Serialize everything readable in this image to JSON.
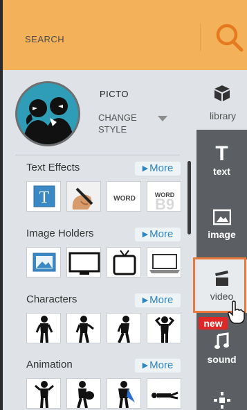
{
  "search": {
    "placeholder": "SEARCH"
  },
  "style": {
    "name": "PICTO",
    "change_line1": "CHANGE",
    "change_line2": "STYLE"
  },
  "library": {
    "label": "library"
  },
  "sections": [
    {
      "title": "Text Effects",
      "more": "More",
      "thumbs": [
        "text-box-icon",
        "pen-hand-thumb",
        "word-outline-thumb",
        "word-textured-thumb"
      ],
      "thumb_text": [
        "WORD",
        "WORD"
      ]
    },
    {
      "title": "Image Holders",
      "more": "More",
      "thumbs": [
        "image-icon",
        "monitor-thumb",
        "tv-thumb",
        "laptop-thumb"
      ]
    },
    {
      "title": "Characters",
      "more": "More",
      "thumbs": [
        "character-1",
        "character-2",
        "character-3",
        "character-4"
      ]
    },
    {
      "title": "Animation",
      "more": "More",
      "thumbs": [
        "animation-1",
        "animation-2",
        "animation-3",
        "animation-4"
      ]
    }
  ],
  "rail": [
    {
      "label": "text",
      "icon": "text-icon"
    },
    {
      "label": "image",
      "icon": "image-icon"
    },
    {
      "label": "video",
      "icon": "clapper-icon"
    },
    {
      "label": "sound",
      "icon": "music-icon"
    },
    {
      "label": "",
      "icon": "effects-icon"
    }
  ],
  "badge": {
    "new": "new"
  },
  "colors": {
    "header": "#f3b25a",
    "rail": "#5b5f64",
    "accent": "#ea7a3c",
    "link": "#2c86c4"
  }
}
